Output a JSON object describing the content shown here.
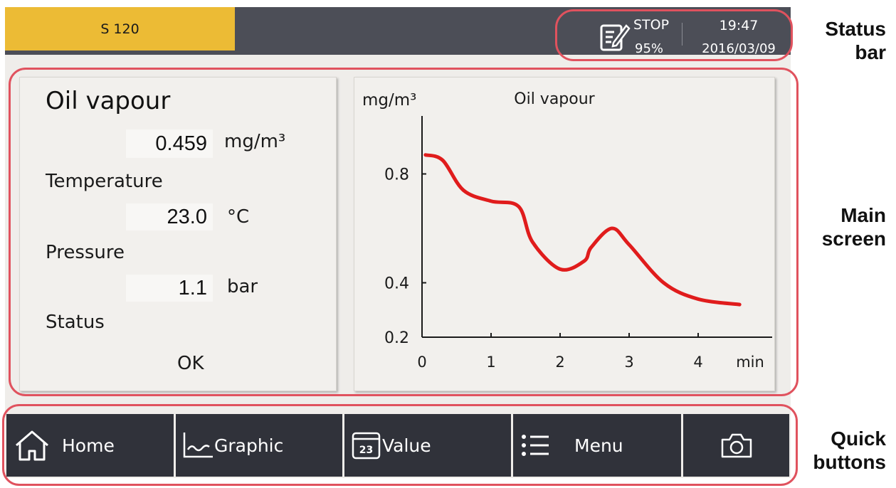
{
  "status_bar": {
    "device_tab": "S 120",
    "run_state": "STOP",
    "memory_percent": "95%",
    "time": "19:47",
    "date": "2016/03/09"
  },
  "values_panel": {
    "title": "Oil vapour",
    "oil_value": "0.459",
    "oil_unit": "mg/m³",
    "temperature_label": "Temperature",
    "temperature_value": "23.0",
    "temperature_unit": "°C",
    "pressure_label": "Pressure",
    "pressure_value": "1.1",
    "pressure_unit": "bar",
    "status_label": "Status",
    "status_value": "OK"
  },
  "chart_data": {
    "type": "line",
    "title": "Oil vapour",
    "ylabel": "mg/m³",
    "xlabel": "min",
    "x_ticks": [
      "0",
      "1",
      "2",
      "3",
      "4"
    ],
    "y_ticks": [
      "0.2",
      "0.4",
      "0.8"
    ],
    "series": [
      {
        "color": "#e01c1c",
        "x": [
          0.05,
          0.3,
          0.6,
          1.0,
          1.4,
          1.6,
          2.0,
          2.35,
          2.45,
          2.75,
          3.0,
          3.5,
          4.0,
          4.6
        ],
        "y": [
          0.87,
          0.85,
          0.74,
          0.7,
          0.68,
          0.55,
          0.45,
          0.48,
          0.53,
          0.6,
          0.54,
          0.4,
          0.34,
          0.32
        ]
      }
    ]
  },
  "quick_buttons": [
    {
      "label": "Home",
      "icon": "home-icon"
    },
    {
      "label": "Graphic",
      "icon": "graph-icon"
    },
    {
      "label": "Value",
      "icon": "calendar-23-icon",
      "icon_text": "23"
    },
    {
      "label": "Menu",
      "icon": "menu-list-icon"
    },
    {
      "label": "",
      "icon": "camera-icon"
    }
  ],
  "annotations": {
    "status_bar": [
      "Status",
      "bar"
    ],
    "main_screen": [
      "Main",
      "screen"
    ],
    "quick_buttons": [
      "Quick",
      "buttons"
    ]
  },
  "colors": {
    "status_bar": "#4c4e57",
    "device_tab": "#ecbb35",
    "screen_bg": "#efedea",
    "button_bg": "#30323a",
    "curve": "#e01c1c",
    "annotation_ring": "#e0525e"
  }
}
